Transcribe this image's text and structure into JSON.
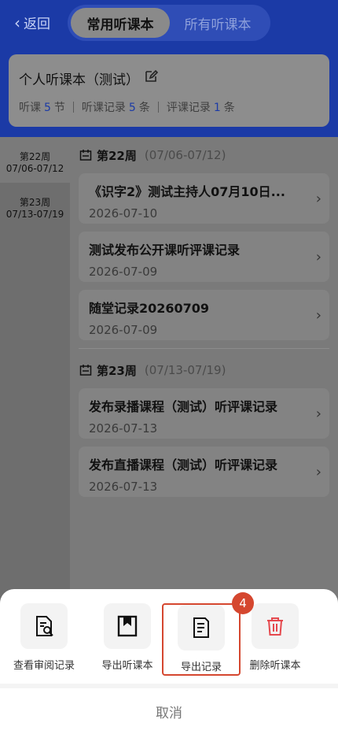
{
  "header": {
    "back_label": "返回",
    "tabs": [
      {
        "label": "常用听课本",
        "active": true
      },
      {
        "label": "所有听课本",
        "active": false
      }
    ]
  },
  "book": {
    "title": "个人听课本（测试）",
    "stats": [
      {
        "prefix": "听课",
        "count": "5",
        "unit": "节"
      },
      {
        "prefix": "听课记录",
        "count": "5",
        "unit": "条"
      },
      {
        "prefix": "评课记录",
        "count": "1",
        "unit": "条"
      }
    ]
  },
  "weeks": [
    {
      "label": "第22周",
      "range": "07/06-07/12",
      "selected": true
    },
    {
      "label": "第23周",
      "range": "07/13-07/19",
      "selected": false
    }
  ],
  "groups": [
    {
      "week": "第22周",
      "range": "(07/06-07/12)",
      "records": [
        {
          "title": "《识字2》测试主持人07月10日...",
          "date": "2026-07-10"
        },
        {
          "title": "测试发布公开课听评课记录",
          "date": "2026-07-09"
        },
        {
          "title": "随堂记录20260709",
          "date": "2026-07-09"
        }
      ]
    },
    {
      "week": "第23周",
      "range": "(07/13-07/19)",
      "records": [
        {
          "title": "发布录播课程（测试）听评课记录",
          "date": "2026-07-13"
        },
        {
          "title": "发布直播课程（测试）听评课记录",
          "date": "2026-07-13"
        }
      ]
    }
  ],
  "sheet": {
    "actions": [
      {
        "label": "查看审阅记录",
        "icon": "review-search-icon"
      },
      {
        "label": "导出听课本",
        "icon": "bookmark-export-icon"
      },
      {
        "label": "导出记录",
        "icon": "document-export-icon"
      },
      {
        "label": "删除听课本",
        "icon": "trash-icon"
      }
    ],
    "badge": "4",
    "cancel_label": "取消"
  },
  "colors": {
    "brand_blue": "#1b3aa6",
    "highlight_red": "#d5472f",
    "delete_red": "#e5484d"
  }
}
